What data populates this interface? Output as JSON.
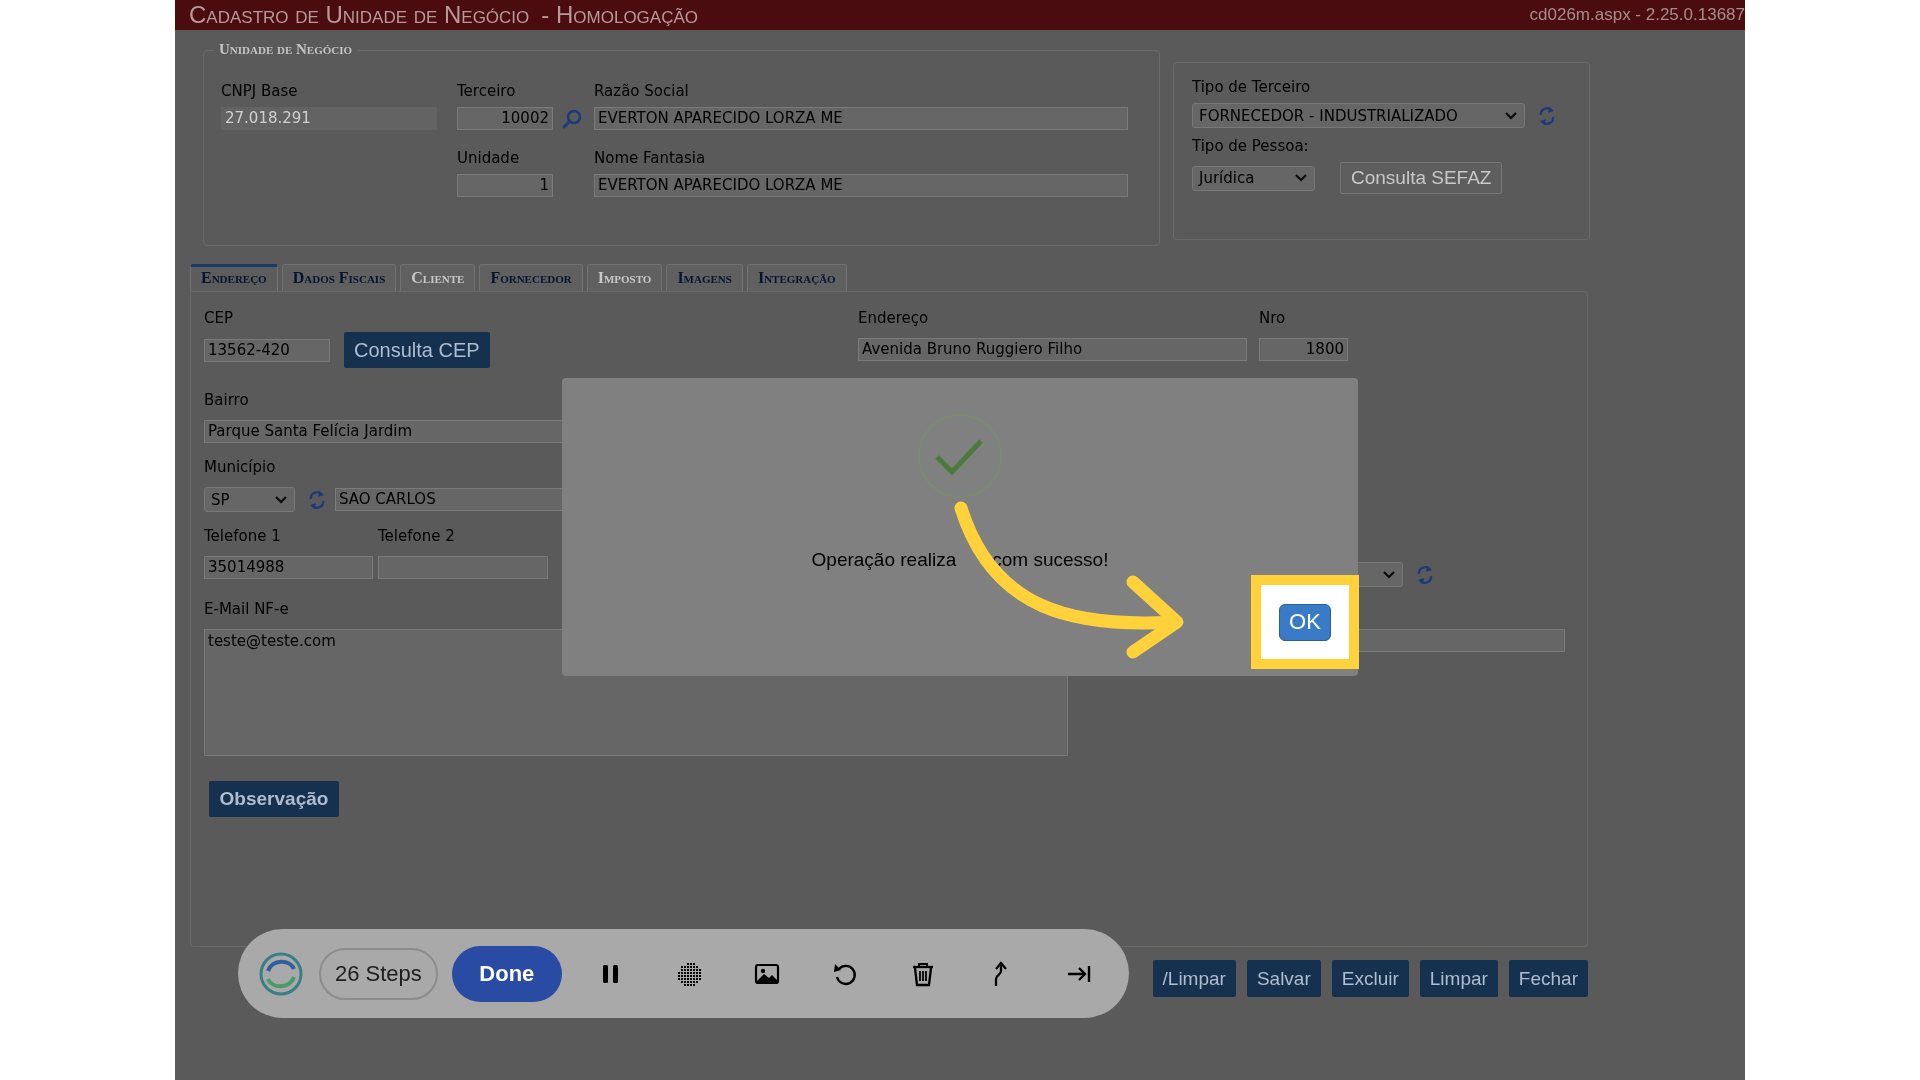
{
  "window": {
    "title": "Cadastro de Unidade de Negócio",
    "environment": "- Homologação",
    "version": "cd026m.aspx - 2.25.0.13687"
  },
  "unit": {
    "legend": "Unidade de Negócio",
    "columns": [
      [
        {
          "label": "CNPJ Base",
          "value": "27.018.291",
          "kind": "readonly"
        }
      ],
      [
        {
          "label": "Terceiro",
          "value": "10002",
          "kind": "lookup"
        },
        {
          "label": "Unidade",
          "value": "1",
          "kind": "number"
        }
      ],
      [
        {
          "label": "Razão Social",
          "value": "EVERTON APARECIDO LORZA ME",
          "kind": "text"
        },
        {
          "label": "Nome Fantasia",
          "value": "EVERTON APARECIDO LORZA ME",
          "kind": "text"
        }
      ]
    ]
  },
  "party": {
    "type_label": "Tipo de Terceiro",
    "type_value": "FORNECEDOR - INDUSTRIALIZADO",
    "person_label": "Tipo de Pessoa:",
    "person_value": "Jurídica",
    "sefaz_button": {
      "label": "Consulta SEFAZ",
      "disabled": true
    }
  },
  "tabs": [
    {
      "label": "Endereço",
      "selected": true,
      "disabled": false
    },
    {
      "label": "Dados Fiscais",
      "selected": false,
      "disabled": false
    },
    {
      "label": "Cliente",
      "selected": false,
      "disabled": true
    },
    {
      "label": "Fornecedor",
      "selected": false,
      "disabled": false
    },
    {
      "label": "Imposto",
      "selected": false,
      "disabled": true
    },
    {
      "label": "Imagens",
      "selected": false,
      "disabled": false
    },
    {
      "label": "Integração",
      "selected": false,
      "disabled": false
    }
  ],
  "address": {
    "cep": {
      "label": "CEP",
      "value": "13562-420"
    },
    "cep_button": "Consulta CEP",
    "street": {
      "label": "Endereço",
      "value": "Avenida Bruno Ruggiero Filho"
    },
    "number": {
      "label": "Nro",
      "value": "1800"
    },
    "district": {
      "label": "Bairro",
      "value": "Parque Santa Felícia Jardim"
    },
    "city": {
      "label": "Município",
      "state": "SP",
      "value": "SAO CARLOS"
    },
    "phone1": {
      "label": "Telefone 1",
      "value": "35014988"
    },
    "phone2": {
      "label": "Telefone 2"
    },
    "email": {
      "label": "E-Mail NF-e",
      "value": "teste@teste.com"
    },
    "notes_button": "Observação"
  },
  "actions": [
    "/Limpar",
    "Salvar",
    "Excluir",
    "Limpar",
    "Fechar"
  ],
  "dialog": {
    "message_parts": [
      "Operação realiza",
      "com sucesso!"
    ],
    "button": "OK",
    "highlighted": true
  },
  "recorder": {
    "steps": "26 Steps",
    "done": "Done"
  }
}
